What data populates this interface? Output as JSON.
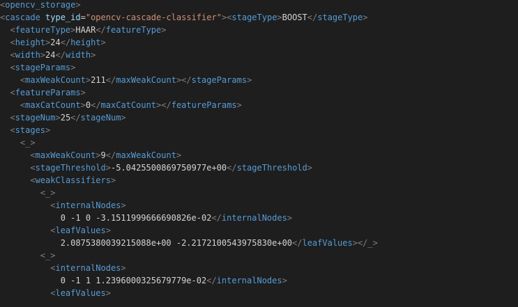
{
  "editor": {
    "colors": {
      "background": "#1e1e1e",
      "tag": "#569cd6",
      "bracket": "#808080",
      "attribute": "#9cdcfe",
      "string": "#ce9178",
      "text": "#d4d4d4"
    },
    "lines": [
      [
        {
          "c": "bracket",
          "t": "<"
        },
        {
          "c": "tag",
          "t": "opencv_storage"
        },
        {
          "c": "bracket",
          "t": ">"
        }
      ],
      [
        {
          "c": "bracket",
          "t": "<"
        },
        {
          "c": "tag",
          "t": "cascade"
        },
        {
          "c": "txt",
          "t": " "
        },
        {
          "c": "attr",
          "t": "type_id"
        },
        {
          "c": "eq",
          "t": "="
        },
        {
          "c": "str",
          "t": "\"opencv-cascade-classifier\""
        },
        {
          "c": "bracket",
          "t": "><"
        },
        {
          "c": "tag",
          "t": "stageType"
        },
        {
          "c": "bracket",
          "t": ">"
        },
        {
          "c": "txt",
          "t": "BOOST"
        },
        {
          "c": "bracket",
          "t": "</"
        },
        {
          "c": "tag",
          "t": "stageType"
        },
        {
          "c": "bracket",
          "t": ">"
        }
      ],
      [
        {
          "c": "txt",
          "t": "  "
        },
        {
          "c": "bracket",
          "t": "<"
        },
        {
          "c": "tag",
          "t": "featureType"
        },
        {
          "c": "bracket",
          "t": ">"
        },
        {
          "c": "txt",
          "t": "HAAR"
        },
        {
          "c": "bracket",
          "t": "</"
        },
        {
          "c": "tag",
          "t": "featureType"
        },
        {
          "c": "bracket",
          "t": ">"
        }
      ],
      [
        {
          "c": "txt",
          "t": "  "
        },
        {
          "c": "bracket",
          "t": "<"
        },
        {
          "c": "tag",
          "t": "height"
        },
        {
          "c": "bracket",
          "t": ">"
        },
        {
          "c": "txt",
          "t": "24"
        },
        {
          "c": "bracket",
          "t": "</"
        },
        {
          "c": "tag",
          "t": "height"
        },
        {
          "c": "bracket",
          "t": ">"
        }
      ],
      [
        {
          "c": "txt",
          "t": "  "
        },
        {
          "c": "bracket",
          "t": "<"
        },
        {
          "c": "tag",
          "t": "width"
        },
        {
          "c": "bracket",
          "t": ">"
        },
        {
          "c": "txt",
          "t": "24"
        },
        {
          "c": "bracket",
          "t": "</"
        },
        {
          "c": "tag",
          "t": "width"
        },
        {
          "c": "bracket",
          "t": ">"
        }
      ],
      [
        {
          "c": "txt",
          "t": "  "
        },
        {
          "c": "bracket",
          "t": "<"
        },
        {
          "c": "tag",
          "t": "stageParams"
        },
        {
          "c": "bracket",
          "t": ">"
        }
      ],
      [
        {
          "c": "txt",
          "t": "    "
        },
        {
          "c": "bracket",
          "t": "<"
        },
        {
          "c": "tag",
          "t": "maxWeakCount"
        },
        {
          "c": "bracket",
          "t": ">"
        },
        {
          "c": "txt",
          "t": "211"
        },
        {
          "c": "bracket",
          "t": "</"
        },
        {
          "c": "tag",
          "t": "maxWeakCount"
        },
        {
          "c": "bracket",
          "t": "></"
        },
        {
          "c": "tag",
          "t": "stageParams"
        },
        {
          "c": "bracket",
          "t": ">"
        }
      ],
      [
        {
          "c": "txt",
          "t": "  "
        },
        {
          "c": "bracket",
          "t": "<"
        },
        {
          "c": "tag",
          "t": "featureParams"
        },
        {
          "c": "bracket",
          "t": ">"
        }
      ],
      [
        {
          "c": "txt",
          "t": "    "
        },
        {
          "c": "bracket",
          "t": "<"
        },
        {
          "c": "tag",
          "t": "maxCatCount"
        },
        {
          "c": "bracket",
          "t": ">"
        },
        {
          "c": "txt",
          "t": "0"
        },
        {
          "c": "bracket",
          "t": "</"
        },
        {
          "c": "tag",
          "t": "maxCatCount"
        },
        {
          "c": "bracket",
          "t": "></"
        },
        {
          "c": "tag",
          "t": "featureParams"
        },
        {
          "c": "bracket",
          "t": ">"
        }
      ],
      [
        {
          "c": "txt",
          "t": "  "
        },
        {
          "c": "bracket",
          "t": "<"
        },
        {
          "c": "tag",
          "t": "stageNum"
        },
        {
          "c": "bracket",
          "t": ">"
        },
        {
          "c": "txt",
          "t": "25"
        },
        {
          "c": "bracket",
          "t": "</"
        },
        {
          "c": "tag",
          "t": "stageNum"
        },
        {
          "c": "bracket",
          "t": ">"
        }
      ],
      [
        {
          "c": "txt",
          "t": "  "
        },
        {
          "c": "bracket",
          "t": "<"
        },
        {
          "c": "tag",
          "t": "stages"
        },
        {
          "c": "bracket",
          "t": ">"
        }
      ],
      [
        {
          "c": "txt",
          "t": "    "
        },
        {
          "c": "bracket",
          "t": "<"
        },
        {
          "c": "tag",
          "t": "_"
        },
        {
          "c": "bracket",
          "t": ">"
        }
      ],
      [
        {
          "c": "txt",
          "t": "      "
        },
        {
          "c": "bracket",
          "t": "<"
        },
        {
          "c": "tag",
          "t": "maxWeakCount"
        },
        {
          "c": "bracket",
          "t": ">"
        },
        {
          "c": "txt",
          "t": "9"
        },
        {
          "c": "bracket",
          "t": "</"
        },
        {
          "c": "tag",
          "t": "maxWeakCount"
        },
        {
          "c": "bracket",
          "t": ">"
        }
      ],
      [
        {
          "c": "txt",
          "t": "      "
        },
        {
          "c": "bracket",
          "t": "<"
        },
        {
          "c": "tag",
          "t": "stageThreshold"
        },
        {
          "c": "bracket",
          "t": ">"
        },
        {
          "c": "txt",
          "t": "-5.0425500869750977e+00"
        },
        {
          "c": "bracket",
          "t": "</"
        },
        {
          "c": "tag",
          "t": "stageThreshold"
        },
        {
          "c": "bracket",
          "t": ">"
        }
      ],
      [
        {
          "c": "txt",
          "t": "      "
        },
        {
          "c": "bracket",
          "t": "<"
        },
        {
          "c": "tag",
          "t": "weakClassifiers"
        },
        {
          "c": "bracket",
          "t": ">"
        }
      ],
      [
        {
          "c": "txt",
          "t": "        "
        },
        {
          "c": "bracket",
          "t": "<"
        },
        {
          "c": "tag",
          "t": "_"
        },
        {
          "c": "bracket",
          "t": ">"
        }
      ],
      [
        {
          "c": "txt",
          "t": "          "
        },
        {
          "c": "bracket",
          "t": "<"
        },
        {
          "c": "tag",
          "t": "internalNodes"
        },
        {
          "c": "bracket",
          "t": ">"
        }
      ],
      [
        {
          "c": "txt",
          "t": "            0 -1 0 -3.1511999666690826e-02"
        },
        {
          "c": "bracket",
          "t": "</"
        },
        {
          "c": "tag",
          "t": "internalNodes"
        },
        {
          "c": "bracket",
          "t": ">"
        }
      ],
      [
        {
          "c": "txt",
          "t": "          "
        },
        {
          "c": "bracket",
          "t": "<"
        },
        {
          "c": "tag",
          "t": "leafValues"
        },
        {
          "c": "bracket",
          "t": ">"
        }
      ],
      [
        {
          "c": "txt",
          "t": "            2.0875380039215088e+00 -2.2172100543975830e+00"
        },
        {
          "c": "bracket",
          "t": "</"
        },
        {
          "c": "tag",
          "t": "leafValues"
        },
        {
          "c": "bracket",
          "t": "></"
        },
        {
          "c": "tag",
          "t": "_"
        },
        {
          "c": "bracket",
          "t": ">"
        }
      ],
      [
        {
          "c": "txt",
          "t": "        "
        },
        {
          "c": "bracket",
          "t": "<"
        },
        {
          "c": "tag",
          "t": "_"
        },
        {
          "c": "bracket",
          "t": ">"
        }
      ],
      [
        {
          "c": "txt",
          "t": "          "
        },
        {
          "c": "bracket",
          "t": "<"
        },
        {
          "c": "tag",
          "t": "internalNodes"
        },
        {
          "c": "bracket",
          "t": ">"
        }
      ],
      [
        {
          "c": "txt",
          "t": "            0 -1 1 1.2396000325679779e-02"
        },
        {
          "c": "bracket",
          "t": "</"
        },
        {
          "c": "tag",
          "t": "internalNodes"
        },
        {
          "c": "bracket",
          "t": ">"
        }
      ],
      [
        {
          "c": "txt",
          "t": "          "
        },
        {
          "c": "bracket",
          "t": "<"
        },
        {
          "c": "tag",
          "t": "leafValues"
        },
        {
          "c": "bracket",
          "t": ">"
        }
      ]
    ]
  }
}
